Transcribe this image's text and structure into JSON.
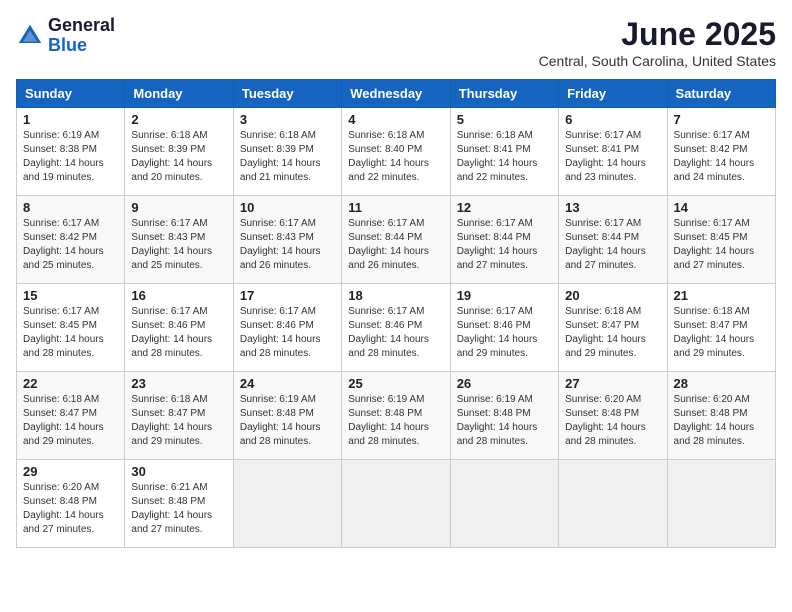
{
  "header": {
    "logo_line1": "General",
    "logo_line2": "Blue",
    "title": "June 2025",
    "subtitle": "Central, South Carolina, United States"
  },
  "days_of_week": [
    "Sunday",
    "Monday",
    "Tuesday",
    "Wednesday",
    "Thursday",
    "Friday",
    "Saturday"
  ],
  "weeks": [
    [
      {
        "day": "1",
        "sunrise": "6:19 AM",
        "sunset": "8:38 PM",
        "daylight": "14 hours and 19 minutes."
      },
      {
        "day": "2",
        "sunrise": "6:18 AM",
        "sunset": "8:39 PM",
        "daylight": "14 hours and 20 minutes."
      },
      {
        "day": "3",
        "sunrise": "6:18 AM",
        "sunset": "8:39 PM",
        "daylight": "14 hours and 21 minutes."
      },
      {
        "day": "4",
        "sunrise": "6:18 AM",
        "sunset": "8:40 PM",
        "daylight": "14 hours and 22 minutes."
      },
      {
        "day": "5",
        "sunrise": "6:18 AM",
        "sunset": "8:41 PM",
        "daylight": "14 hours and 22 minutes."
      },
      {
        "day": "6",
        "sunrise": "6:17 AM",
        "sunset": "8:41 PM",
        "daylight": "14 hours and 23 minutes."
      },
      {
        "day": "7",
        "sunrise": "6:17 AM",
        "sunset": "8:42 PM",
        "daylight": "14 hours and 24 minutes."
      }
    ],
    [
      {
        "day": "8",
        "sunrise": "6:17 AM",
        "sunset": "8:42 PM",
        "daylight": "14 hours and 25 minutes."
      },
      {
        "day": "9",
        "sunrise": "6:17 AM",
        "sunset": "8:43 PM",
        "daylight": "14 hours and 25 minutes."
      },
      {
        "day": "10",
        "sunrise": "6:17 AM",
        "sunset": "8:43 PM",
        "daylight": "14 hours and 26 minutes."
      },
      {
        "day": "11",
        "sunrise": "6:17 AM",
        "sunset": "8:44 PM",
        "daylight": "14 hours and 26 minutes."
      },
      {
        "day": "12",
        "sunrise": "6:17 AM",
        "sunset": "8:44 PM",
        "daylight": "14 hours and 27 minutes."
      },
      {
        "day": "13",
        "sunrise": "6:17 AM",
        "sunset": "8:44 PM",
        "daylight": "14 hours and 27 minutes."
      },
      {
        "day": "14",
        "sunrise": "6:17 AM",
        "sunset": "8:45 PM",
        "daylight": "14 hours and 27 minutes."
      }
    ],
    [
      {
        "day": "15",
        "sunrise": "6:17 AM",
        "sunset": "8:45 PM",
        "daylight": "14 hours and 28 minutes."
      },
      {
        "day": "16",
        "sunrise": "6:17 AM",
        "sunset": "8:46 PM",
        "daylight": "14 hours and 28 minutes."
      },
      {
        "day": "17",
        "sunrise": "6:17 AM",
        "sunset": "8:46 PM",
        "daylight": "14 hours and 28 minutes."
      },
      {
        "day": "18",
        "sunrise": "6:17 AM",
        "sunset": "8:46 PM",
        "daylight": "14 hours and 28 minutes."
      },
      {
        "day": "19",
        "sunrise": "6:17 AM",
        "sunset": "8:46 PM",
        "daylight": "14 hours and 29 minutes."
      },
      {
        "day": "20",
        "sunrise": "6:18 AM",
        "sunset": "8:47 PM",
        "daylight": "14 hours and 29 minutes."
      },
      {
        "day": "21",
        "sunrise": "6:18 AM",
        "sunset": "8:47 PM",
        "daylight": "14 hours and 29 minutes."
      }
    ],
    [
      {
        "day": "22",
        "sunrise": "6:18 AM",
        "sunset": "8:47 PM",
        "daylight": "14 hours and 29 minutes."
      },
      {
        "day": "23",
        "sunrise": "6:18 AM",
        "sunset": "8:47 PM",
        "daylight": "14 hours and 29 minutes."
      },
      {
        "day": "24",
        "sunrise": "6:19 AM",
        "sunset": "8:48 PM",
        "daylight": "14 hours and 28 minutes."
      },
      {
        "day": "25",
        "sunrise": "6:19 AM",
        "sunset": "8:48 PM",
        "daylight": "14 hours and 28 minutes."
      },
      {
        "day": "26",
        "sunrise": "6:19 AM",
        "sunset": "8:48 PM",
        "daylight": "14 hours and 28 minutes."
      },
      {
        "day": "27",
        "sunrise": "6:20 AM",
        "sunset": "8:48 PM",
        "daylight": "14 hours and 28 minutes."
      },
      {
        "day": "28",
        "sunrise": "6:20 AM",
        "sunset": "8:48 PM",
        "daylight": "14 hours and 28 minutes."
      }
    ],
    [
      {
        "day": "29",
        "sunrise": "6:20 AM",
        "sunset": "8:48 PM",
        "daylight": "14 hours and 27 minutes."
      },
      {
        "day": "30",
        "sunrise": "6:21 AM",
        "sunset": "8:48 PM",
        "daylight": "14 hours and 27 minutes."
      },
      null,
      null,
      null,
      null,
      null
    ]
  ]
}
